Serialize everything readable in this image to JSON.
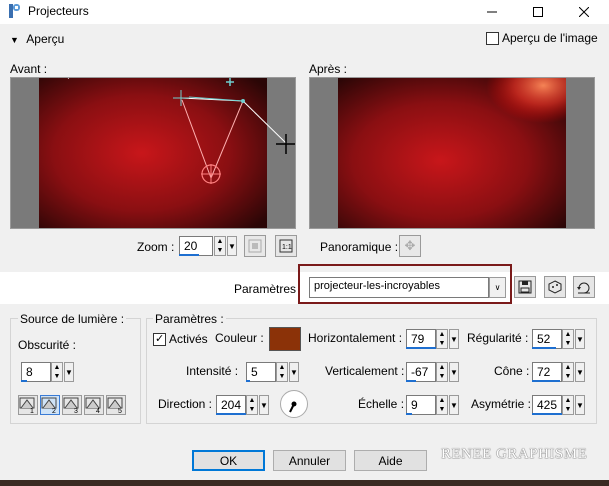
{
  "window": {
    "title": "Projecteurs",
    "minimize_icon": "minimize-icon",
    "maximize_icon": "maximize-icon",
    "close_icon": "close-icon"
  },
  "header": {
    "apercu_label": "Aperçu",
    "apercu_image_label": "Aperçu de l'image",
    "apercu_image_checked": false
  },
  "preview": {
    "before_label": "Avant :",
    "after_label": "Après :"
  },
  "zoom": {
    "label": "Zoom :",
    "value": "20",
    "panoramique_label": "Panoramique :"
  },
  "presets": {
    "label": "Paramètres",
    "selected": "projecteur-les-incroyables"
  },
  "light_source": {
    "group_label": "Source de lumière :",
    "obscurity_label": "Obscurité :",
    "obscurity_value": "8",
    "lights": [
      "1",
      "2",
      "3",
      "4",
      "5"
    ]
  },
  "params": {
    "group_label": "Paramètres :",
    "active_label": "Activés",
    "active_checked": true,
    "color_label": "Couleur :",
    "color_value": "#8b3208",
    "intensity_label": "Intensité :",
    "intensity_value": "5",
    "direction_label": "Direction :",
    "direction_value": "204",
    "horizontal_label": "Horizontalement :",
    "horizontal_value": "79",
    "vertical_label": "Verticalement :",
    "vertical_value": "-67",
    "scale_label": "Échelle :",
    "scale_value": "9",
    "regularity_label": "Régularité :",
    "regularity_value": "52",
    "cone_label": "Cône :",
    "cone_value": "72",
    "asymmetry_label": "Asymétrie :",
    "asymmetry_value": "425"
  },
  "buttons": {
    "ok": "OK",
    "cancel": "Annuler",
    "help": "Aide"
  },
  "watermark": "RENEE GRAPHISME"
}
